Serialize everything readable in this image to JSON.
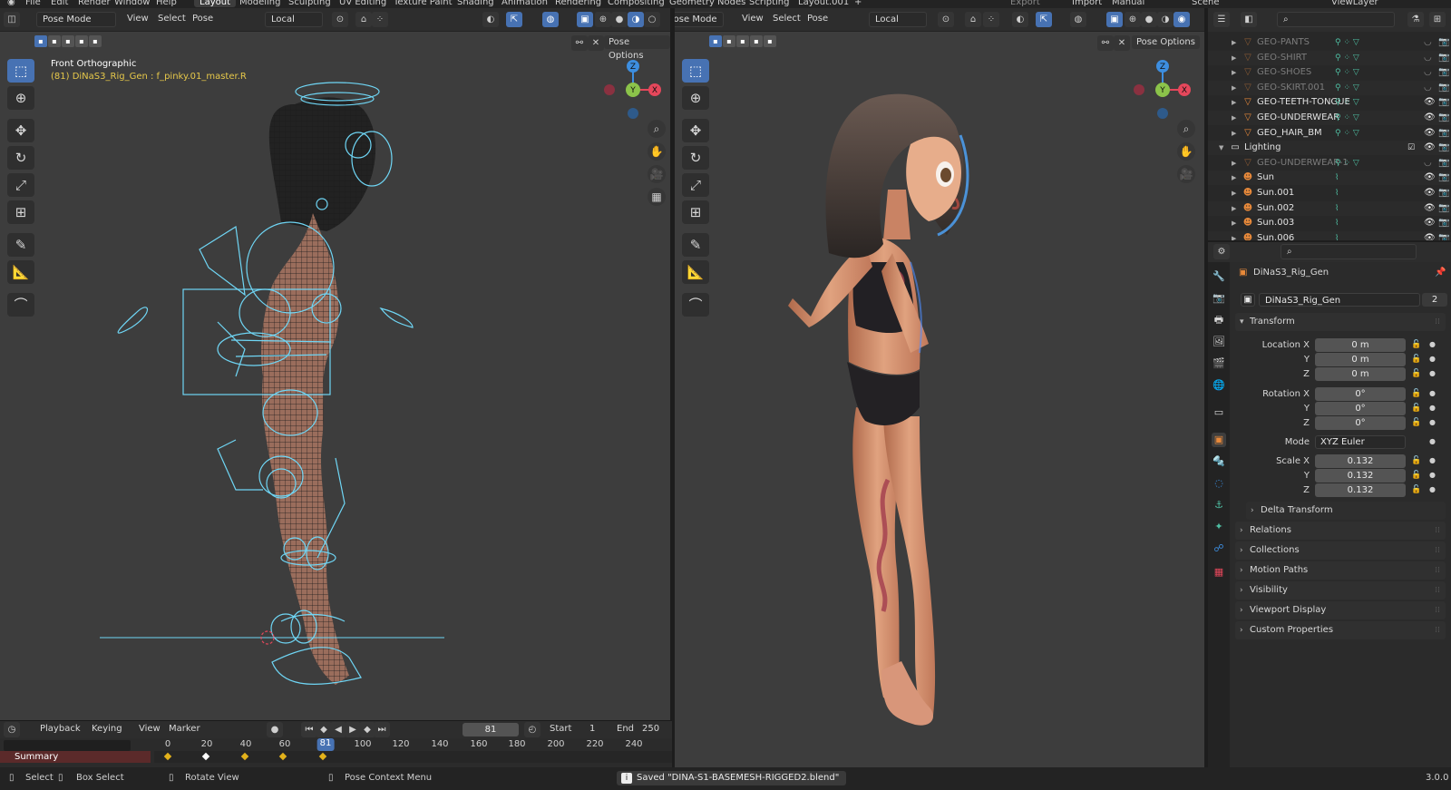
{
  "topbar": {
    "menus": [
      "File",
      "Edit",
      "Render",
      "Window",
      "Help"
    ],
    "workspaces": [
      "Layout",
      "Modeling",
      "Sculpting",
      "UV Editing",
      "Texture Paint",
      "Shading",
      "Animation",
      "Rendering",
      "Compositing",
      "Geometry Nodes",
      "Scripting",
      "Layout.001"
    ],
    "add": "+",
    "right": {
      "export": "Export",
      "import": "Import",
      "manual": "Manual",
      "scene": "Scene",
      "view_layer": "ViewLayer"
    }
  },
  "viewport_left": {
    "mode": "Pose Mode",
    "menus": [
      "View",
      "Select",
      "Pose"
    ],
    "transform_orientation": "Local",
    "pose_options": "Pose Options",
    "overlay_title": "Front Orthographic",
    "overlay_subtitle": "(81) DiNaS3_Rig_Gen : f_pinky.01_master.R",
    "gizmo": {
      "z": "Z",
      "y": "Y",
      "x": "X"
    }
  },
  "viewport_right": {
    "mode": "Pose Mode",
    "menus": [
      "View",
      "Select",
      "Pose"
    ],
    "transform_orientation": "Local",
    "pose_options": "Pose Options",
    "gizmo": {
      "z": "Z",
      "y": "Y",
      "x": "X"
    }
  },
  "timeline": {
    "menus": [
      "Playback",
      "Keying",
      "View",
      "Marker"
    ],
    "current_frame": "81",
    "start_label": "Start",
    "start": "1",
    "end_label": "End",
    "end": "250",
    "ruler": [
      "0",
      "20",
      "40",
      "60",
      "81",
      "100",
      "120",
      "140",
      "160",
      "180",
      "200",
      "220",
      "240"
    ],
    "summary": "Summary"
  },
  "statusbar": {
    "select": "Select",
    "box_select": "Box Select",
    "rotate_view": "Rotate View",
    "context_menu": "Pose Context Menu",
    "saved": "Saved \"DINA-S1-BASEMESH-RIGGED2.blend\"",
    "version": "3.0.0"
  },
  "outliner": {
    "rows": [
      {
        "name": "GEO-PANTS",
        "kind": "mesh",
        "dim": true,
        "indent": 2
      },
      {
        "name": "GEO-SHIRT",
        "kind": "mesh",
        "dim": true,
        "indent": 2
      },
      {
        "name": "GEO-SHOES",
        "kind": "mesh",
        "dim": true,
        "indent": 2
      },
      {
        "name": "GEO-SKIRT.001",
        "kind": "mesh",
        "dim": true,
        "indent": 2
      },
      {
        "name": "GEO-TEETH-TONGUE",
        "kind": "mesh",
        "dim": false,
        "indent": 2
      },
      {
        "name": "GEO-UNDERWEAR",
        "kind": "mesh",
        "dim": false,
        "indent": 2
      },
      {
        "name": "GEO_HAIR_BM",
        "kind": "mesh",
        "dim": false,
        "indent": 2
      },
      {
        "name": "Lighting",
        "kind": "collection",
        "dim": false,
        "indent": 1
      },
      {
        "name": "GEO-UNDERWEAR-1",
        "kind": "mesh",
        "dim": true,
        "indent": 2
      },
      {
        "name": "Sun",
        "kind": "light",
        "dim": false,
        "indent": 2
      },
      {
        "name": "Sun.001",
        "kind": "light",
        "dim": false,
        "indent": 2
      },
      {
        "name": "Sun.002",
        "kind": "light",
        "dim": false,
        "indent": 2
      },
      {
        "name": "Sun.003",
        "kind": "light",
        "dim": false,
        "indent": 2
      },
      {
        "name": "Sun.006",
        "kind": "light",
        "dim": false,
        "indent": 2
      }
    ]
  },
  "properties": {
    "object_name": "DiNaS3_Rig_Gen",
    "data_name": "DiNaS3_Rig_Gen",
    "users": "2",
    "transform": {
      "header": "Transform",
      "location_label": "Location X",
      "location": [
        "0 m",
        "0 m",
        "0 m"
      ],
      "rotation_label": "Rotation X",
      "rotation": [
        "0°",
        "0°",
        "0°"
      ],
      "mode_label": "Mode",
      "mode": "XYZ Euler",
      "scale_label": "Scale X",
      "scale": [
        "0.132",
        "0.132",
        "0.132"
      ],
      "y_label": "Y",
      "z_label": "Z",
      "delta": "Delta Transform"
    },
    "panels": [
      "Relations",
      "Collections",
      "Motion Paths",
      "Visibility",
      "Viewport Display",
      "Custom Properties"
    ]
  },
  "colors": {
    "accent": "#4772b3",
    "viewport_bg": "#3d3d3d",
    "rig_lines": "#6fd6f5",
    "overlay_yellow": "#e6c84a",
    "mesh_icon": "#e8893a",
    "axis_x": "#e5475b",
    "axis_y": "#8bc34a",
    "axis_z": "#3d8ee0"
  }
}
